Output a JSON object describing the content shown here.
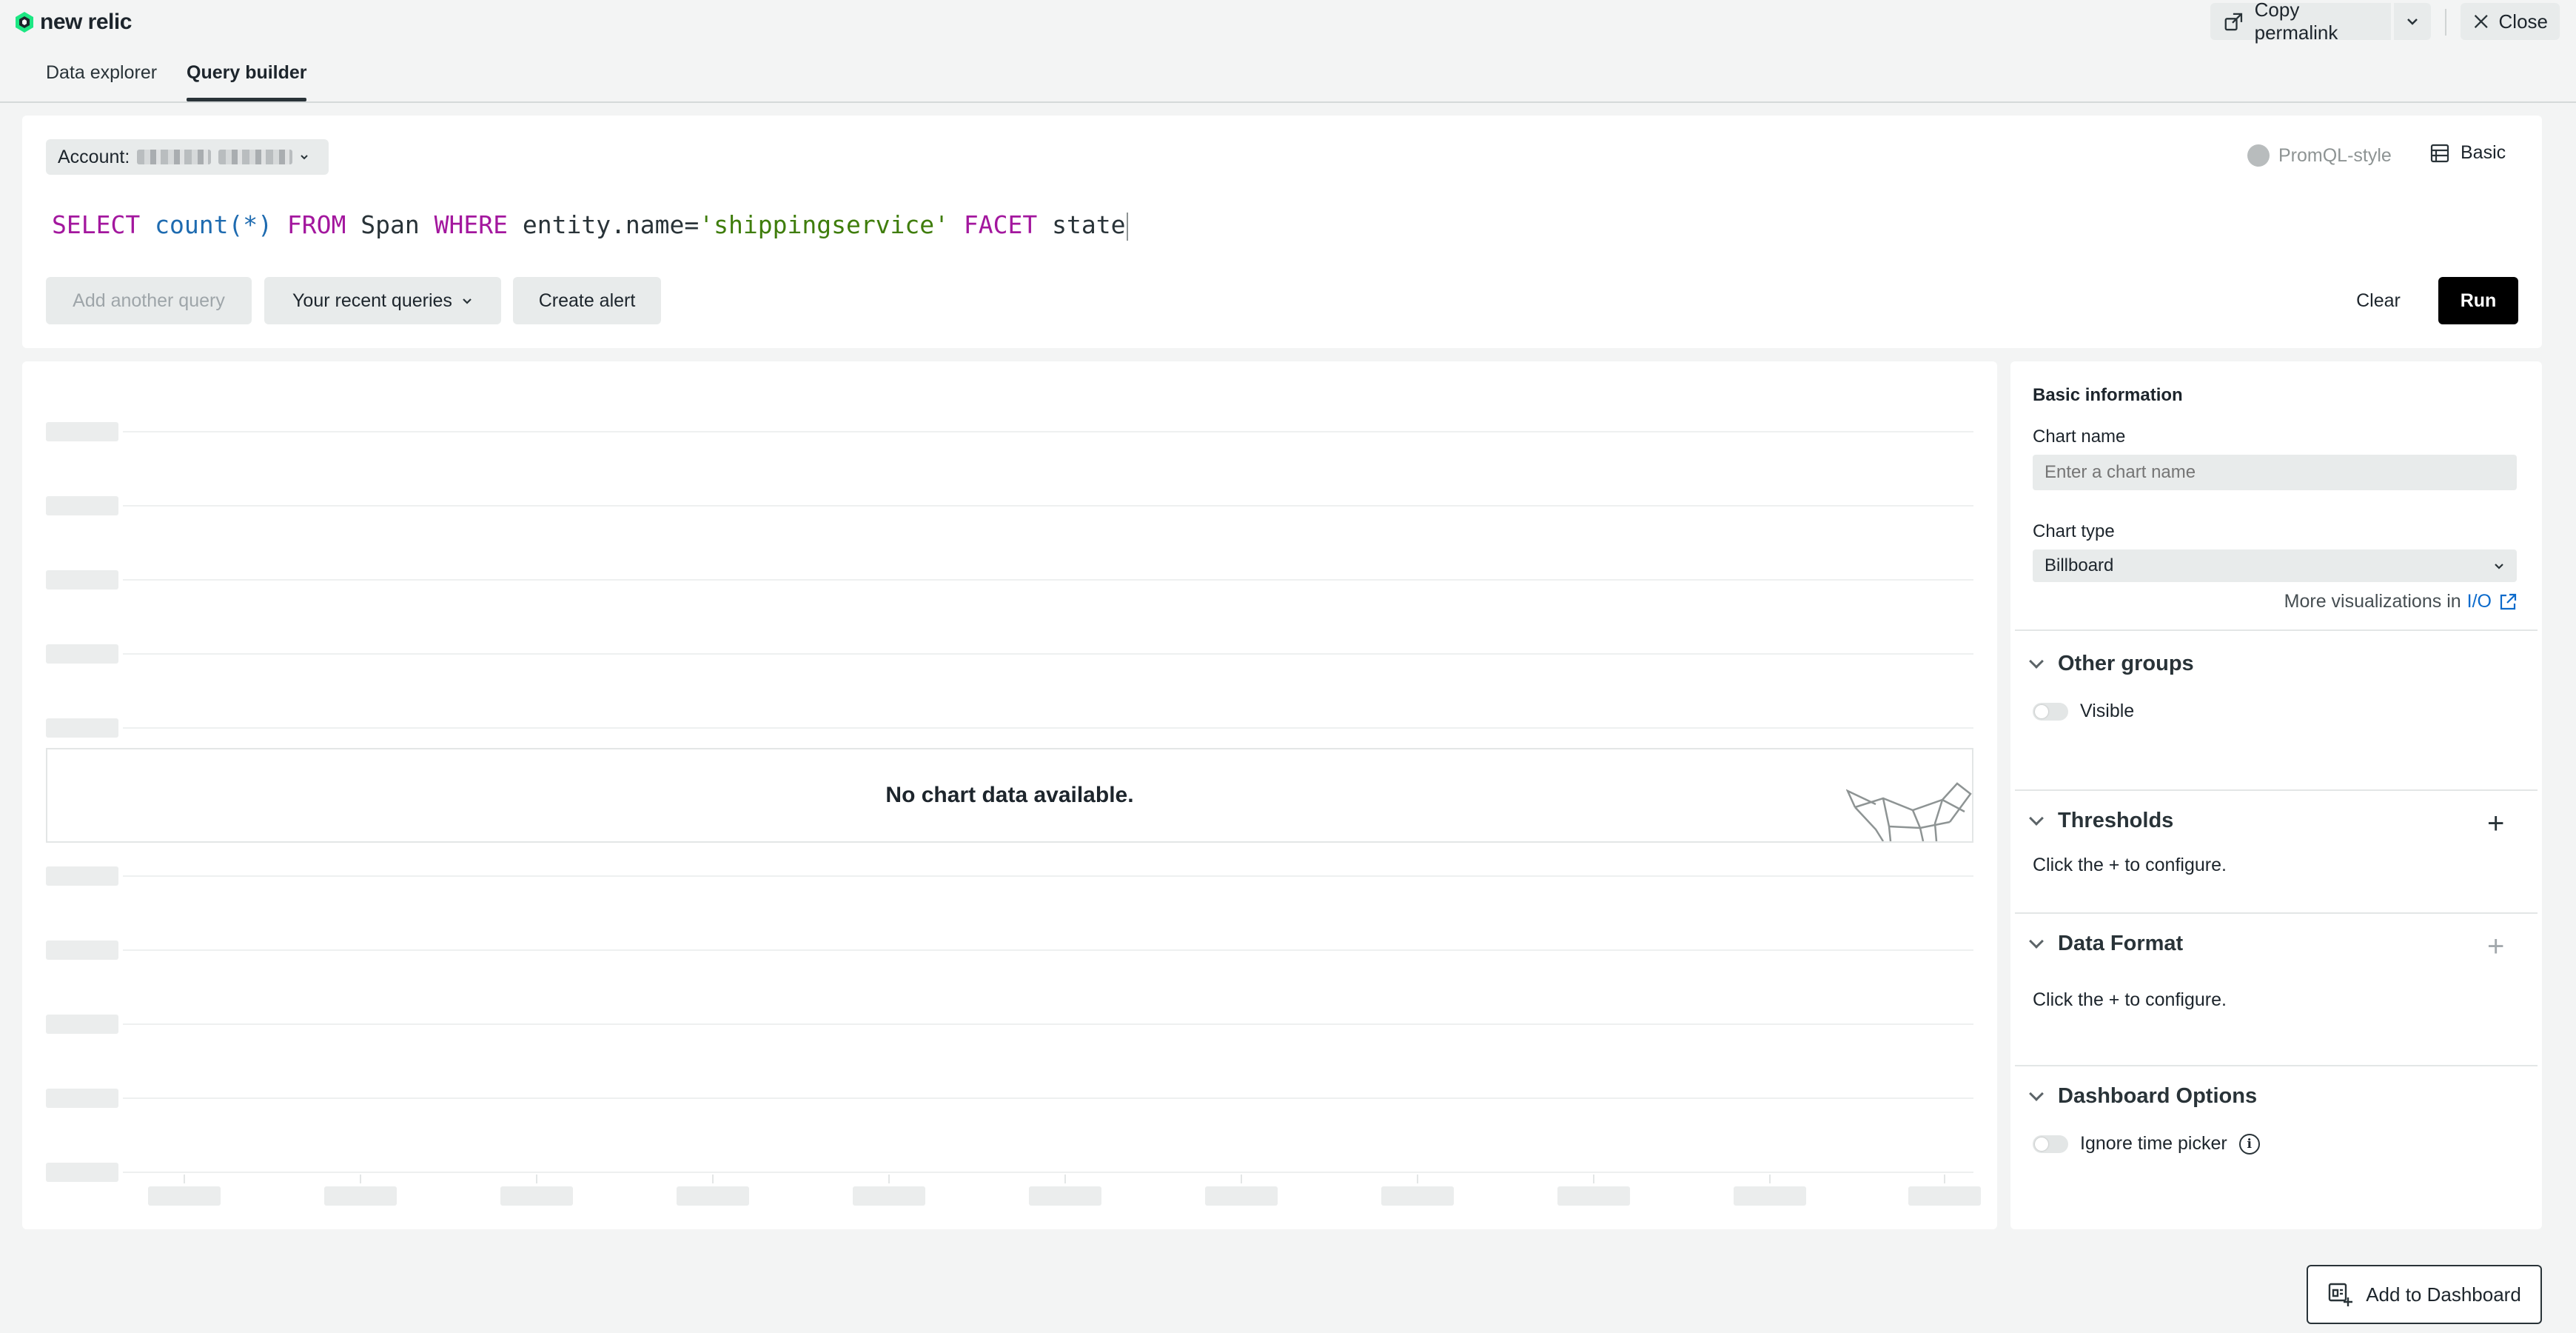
{
  "app": {
    "logo_text": "new relic"
  },
  "header": {
    "copy_permalink_label": "Copy permalink",
    "close_label": "Close"
  },
  "tabs": [
    {
      "label": "Data explorer",
      "active": false
    },
    {
      "label": "Query builder",
      "active": true
    }
  ],
  "query": {
    "account_label": "Account:",
    "promql_label": "PromQL-style",
    "basic_label": "Basic",
    "nrql": {
      "select": "SELECT",
      "fn": "count",
      "arg": "(*)",
      "from": "FROM",
      "table": "Span",
      "where": "WHERE",
      "field": "entity.name=",
      "value": "'shippingservice'",
      "facet": "FACET",
      "facet_field": "state"
    },
    "add_another_label": "Add another query",
    "recent_label": "Your recent queries",
    "create_alert_label": "Create alert",
    "clear_label": "Clear",
    "run_label": "Run"
  },
  "chart": {
    "empty_message": "No chart data available."
  },
  "config": {
    "basic_info_title": "Basic information",
    "chart_name_label": "Chart name",
    "chart_name_placeholder": "Enter a chart name",
    "chart_type_label": "Chart type",
    "chart_type_value": "Billboard",
    "more_viz_text": "More visualizations in",
    "more_viz_link": "I/O",
    "sections": {
      "other_groups": {
        "title": "Other groups",
        "toggle_label": "Visible",
        "toggle_on": false
      },
      "thresholds": {
        "title": "Thresholds",
        "hint": "Click the + to configure."
      },
      "data_format": {
        "title": "Data Format",
        "hint": "Click the + to configure."
      },
      "dashboard_options": {
        "title": "Dashboard Options",
        "toggle_label": "Ignore time picker",
        "toggle_on": false
      }
    }
  },
  "footer": {
    "add_to_dashboard_label": "Add to Dashboard"
  },
  "colors": {
    "keyword": "#a3179e",
    "function": "#1e6bb0",
    "string": "#3f7d0c",
    "link": "#0b6acb",
    "run_button": "#000000"
  }
}
